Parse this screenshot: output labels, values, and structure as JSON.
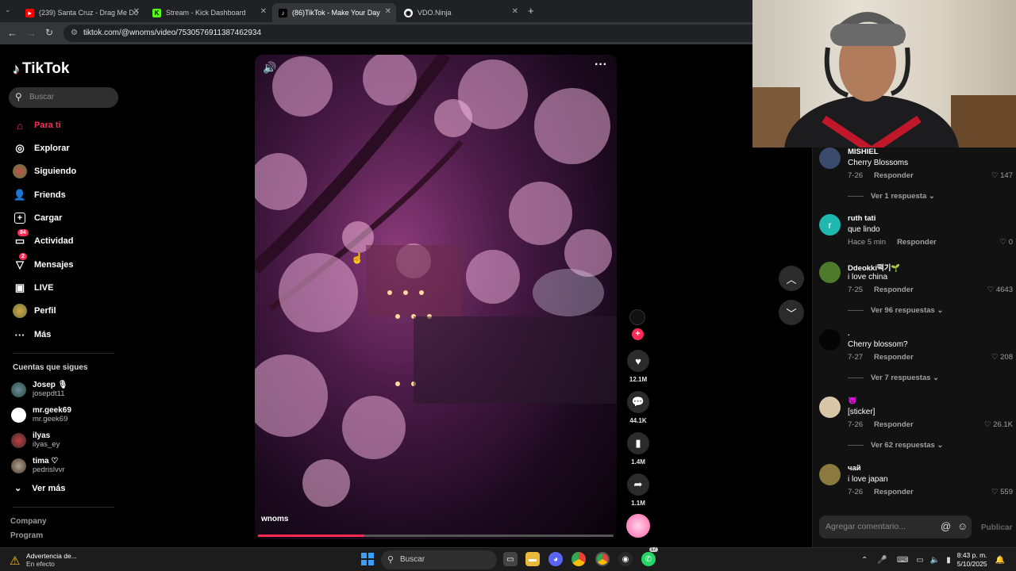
{
  "browser": {
    "tabs": [
      {
        "label": "(239) Santa Cruz - Drag Me Do",
        "favicon": "youtube-icon",
        "color": "#ff0000"
      },
      {
        "label": "Stream - Kick Dashboard",
        "favicon": "kick-icon",
        "color": "#53fc18"
      },
      {
        "label": "(86)TikTok - Make Your Day",
        "favicon": "tiktok-icon",
        "color": "#000000"
      },
      {
        "label": "VDO.Ninja",
        "favicon": "vdo-icon",
        "color": "#ffffff"
      }
    ],
    "url": "tiktok.com/@wnoms/video/7530576911387462934"
  },
  "sidebar": {
    "brand": "TikTok",
    "search_placeholder": "Buscar",
    "nav": [
      {
        "label": "Para ti",
        "icon": "home-icon",
        "active": true
      },
      {
        "label": "Explorar",
        "icon": "compass-icon"
      },
      {
        "label": "Siguiendo",
        "icon": "following-avatar-icon"
      },
      {
        "label": "Friends",
        "icon": "friends-icon"
      },
      {
        "label": "Cargar",
        "icon": "upload-icon"
      },
      {
        "label": "Actividad",
        "icon": "inbox-icon",
        "badge": "84"
      },
      {
        "label": "Mensajes",
        "icon": "send-icon",
        "badge": "2"
      },
      {
        "label": "LIVE",
        "icon": "live-icon"
      },
      {
        "label": "Perfil",
        "icon": "profile-avatar-icon"
      },
      {
        "label": "Más",
        "icon": "more-icon"
      }
    ],
    "following_title": "Cuentas que sigues",
    "following": [
      {
        "name": "Josep 🎙",
        "handle": "josepdt11"
      },
      {
        "name": "mr.geek69",
        "handle": "mr.geek69"
      },
      {
        "name": "ilyas",
        "handle": "ilyas_ey"
      },
      {
        "name": "tima ♡",
        "handle": "pedrislvvr"
      }
    ],
    "see_more": "Ver más",
    "footer": [
      "Company",
      "Program"
    ]
  },
  "video": {
    "author": "wnoms",
    "progress": 0.3
  },
  "actions": {
    "likes": "12.1M",
    "comments": "44.1K",
    "saves": "1.4M",
    "shares": "1.1M"
  },
  "comments": [
    {
      "user": "MISHIEL",
      "text": "Cherry Blossoms",
      "date": "7-26",
      "reply": "Responder",
      "likes": "147",
      "more": "Ver 1 respuesta",
      "avatar_color": "#3a4a6a"
    },
    {
      "user": "ruth tati",
      "text": "que lindo",
      "date": "Hace 5 min",
      "reply": "Responder",
      "likes": "0",
      "avatar_letter": "r",
      "avatar_color": "#1fb8b0"
    },
    {
      "user": "Ddeokki떡기🌱",
      "text": "i love china",
      "date": "7-25",
      "reply": "Responder",
      "likes": "4643",
      "more": "Ver 96 respuestas",
      "avatar_color": "#4e7a2b"
    },
    {
      "user": ".",
      "text": "Cherry blossom?",
      "date": "7-27",
      "reply": "Responder",
      "likes": "208",
      "more": "Ver 7 respuestas",
      "avatar_color": "#050505"
    },
    {
      "user": "👿",
      "text": "[sticker]",
      "date": "7-26",
      "reply": "Responder",
      "likes": "26.1K",
      "more": "Ver 62 respuestas",
      "avatar_color": "#d8c6a8"
    },
    {
      "user": "чай",
      "text": "i love japan",
      "date": "7-26",
      "reply": "Responder",
      "likes": "559",
      "avatar_color": "#8a7a40"
    }
  ],
  "comment_input": {
    "placeholder": "Agregar comentario...",
    "publish": "Publicar"
  },
  "taskbar": {
    "warning_title": "Advertencia de...",
    "warning_sub": "En efecto",
    "search": "Buscar",
    "time": "8:43 p. m.",
    "date": "5/10/2025",
    "notif_badge": "17"
  },
  "colors": {
    "accent": "#fe2c55",
    "bg": "#000000"
  }
}
